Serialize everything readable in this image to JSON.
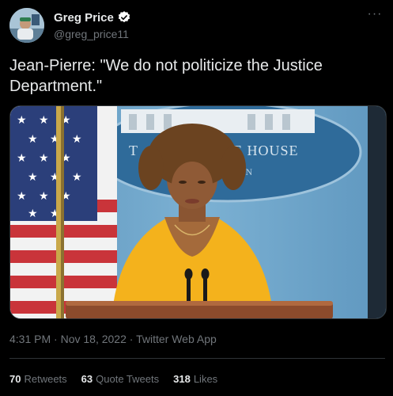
{
  "author": {
    "display_name": "Greg Price",
    "handle": "@greg_price11",
    "verified": true
  },
  "tweet": {
    "text": "Jean-Pierre: \"We do not politicize the Justice Department.\"",
    "time": "4:31 PM",
    "date": "Nov 18, 2022",
    "source": "Twitter Web App",
    "separator": "·"
  },
  "media": {
    "backdrop_text_1": "T",
    "backdrop_text_2": "E HOUSE",
    "backdrop_text_3": "GTON"
  },
  "stats": {
    "retweets_count": "70",
    "retweets_label": "Retweets",
    "quotes_count": "63",
    "quotes_label": "Quote Tweets",
    "likes_count": "318",
    "likes_label": "Likes"
  },
  "colors": {
    "background": "#000000",
    "text": "#e7e9ea",
    "secondary": "#71767b",
    "verified": "#ffffff",
    "border": "#2f3336"
  }
}
